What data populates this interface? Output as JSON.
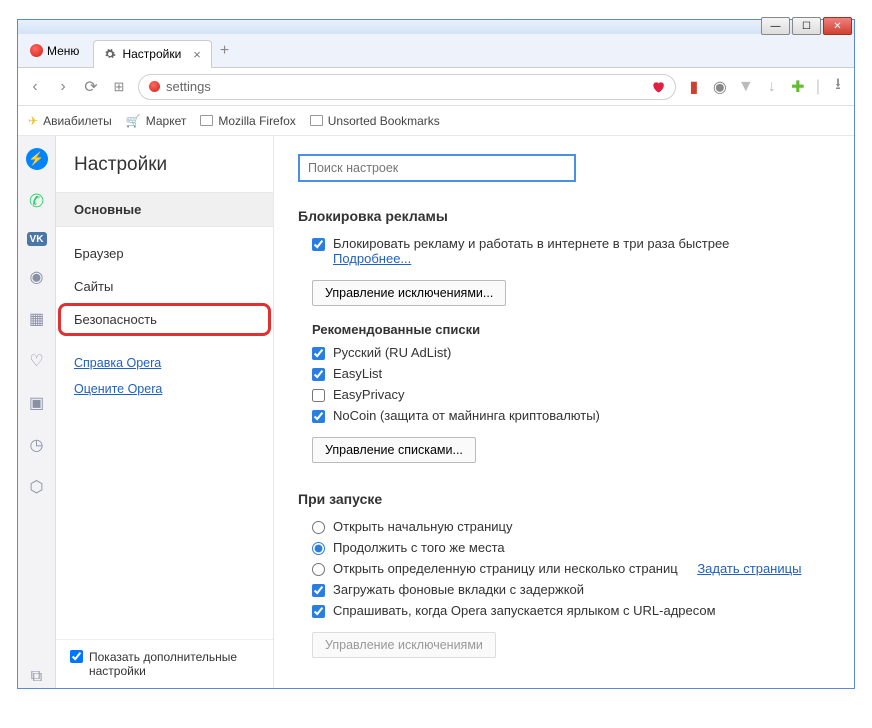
{
  "window": {
    "menu_label": "Меню"
  },
  "tab": {
    "title": "Настройки"
  },
  "address": {
    "value": "settings"
  },
  "bookmarks": {
    "items": [
      {
        "label": "Авиабилеты"
      },
      {
        "label": "Маркет"
      },
      {
        "label": "Mozilla Firefox"
      },
      {
        "label": "Unsorted Bookmarks"
      }
    ]
  },
  "settings": {
    "title": "Настройки",
    "nav": {
      "basic": "Основные",
      "browser": "Браузер",
      "sites": "Сайты",
      "security": "Безопасность",
      "help": "Справка Opera",
      "rate": "Оцените Opera",
      "advanced": "Показать дополнительные настройки"
    },
    "search_placeholder": "Поиск настроек",
    "ads": {
      "heading": "Блокировка рекламы",
      "block_label": "Блокировать рекламу и работать в интернете в три раза быстрее",
      "more": "Подробнее...",
      "manage_exceptions": "Управление исключениями...",
      "recommended": "Рекомендованные списки",
      "lists": {
        "ru": "Русский (RU AdList)",
        "easylist": "EasyList",
        "easyprivacy": "EasyPrivacy",
        "nocoin": "NoCoin (защита от майнинга криптовалюты)"
      },
      "manage_lists": "Управление списками..."
    },
    "startup": {
      "heading": "При запуске",
      "open_start": "Открыть начальную страницу",
      "continue": "Продолжить с того же места",
      "open_specific": "Открыть определенную страницу или несколько страниц",
      "set_pages": "Задать страницы",
      "background_tabs": "Загружать фоновые вкладки с задержкой",
      "ask_shortcut": "Спрашивать, когда Opera запускается ярлыком с URL-адресом",
      "manage_exceptions": "Управление исключениями"
    }
  }
}
